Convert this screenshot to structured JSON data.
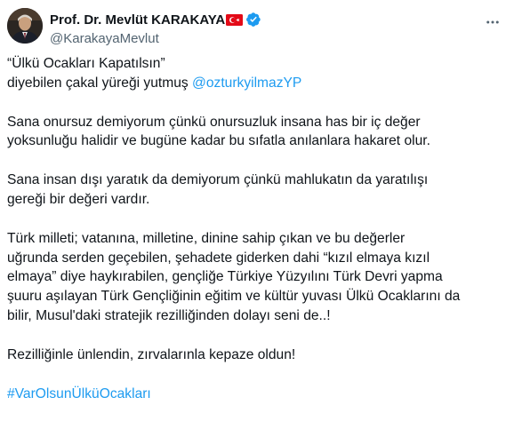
{
  "author": {
    "display_name": "Prof. Dr. Mevlüt KARAKAYA",
    "handle": "@KarakayaMevlut",
    "flag_icon": "turkey-flag-icon",
    "verified_icon": "verified-badge-icon",
    "verified_color": "#1d9bf0"
  },
  "tweet": {
    "p1_line1": "“Ülkü Ocakları Kapatılsın”",
    "p1_line2_text": "diyebilen çakal yüreği yutmuş ",
    "p1_mention": "@ozturkyilmazYP",
    "p2_line1": "Sana onursuz demiyorum çünkü onursuzluk insana has bir iç değer",
    "p2_line2": "yoksunluğu halidir ve bugüne kadar bu sıfatla anılanlara hakaret olur.",
    "p3_line1": "Sana insan dışı yaratık da demiyorum çünkü mahlukatın da yaratılışı",
    "p3_line2": "gereği bir değeri vardır.",
    "p4_line1": "Türk milleti; vatanına, milletine, dinine sahip çıkan ve bu değerler",
    "p4_line2": "uğrunda serden geçebilen, şehadete giderken dahi “kızıl elmaya kızıl",
    "p4_line3": "elmaya” diye haykırabilen, gençliğe Türkiye Yüzyılını Türk Devri yapma",
    "p4_line4": "şuuru aşılayan Türk Gençliğinin eğitim ve kültür yuvası Ülkü Ocaklarını da",
    "p4_line5": "bilir, Musul'daki stratejik rezilliğinden dolayı seni de..!",
    "p5_line1": "Rezilliğinle ünlendin, zırvalarınla kepaze oldun!",
    "hashtag": "#VarOlsunÜlküOcakları"
  },
  "colors": {
    "text": "#0f1419",
    "secondary": "#536471",
    "link": "#1d9bf0"
  }
}
